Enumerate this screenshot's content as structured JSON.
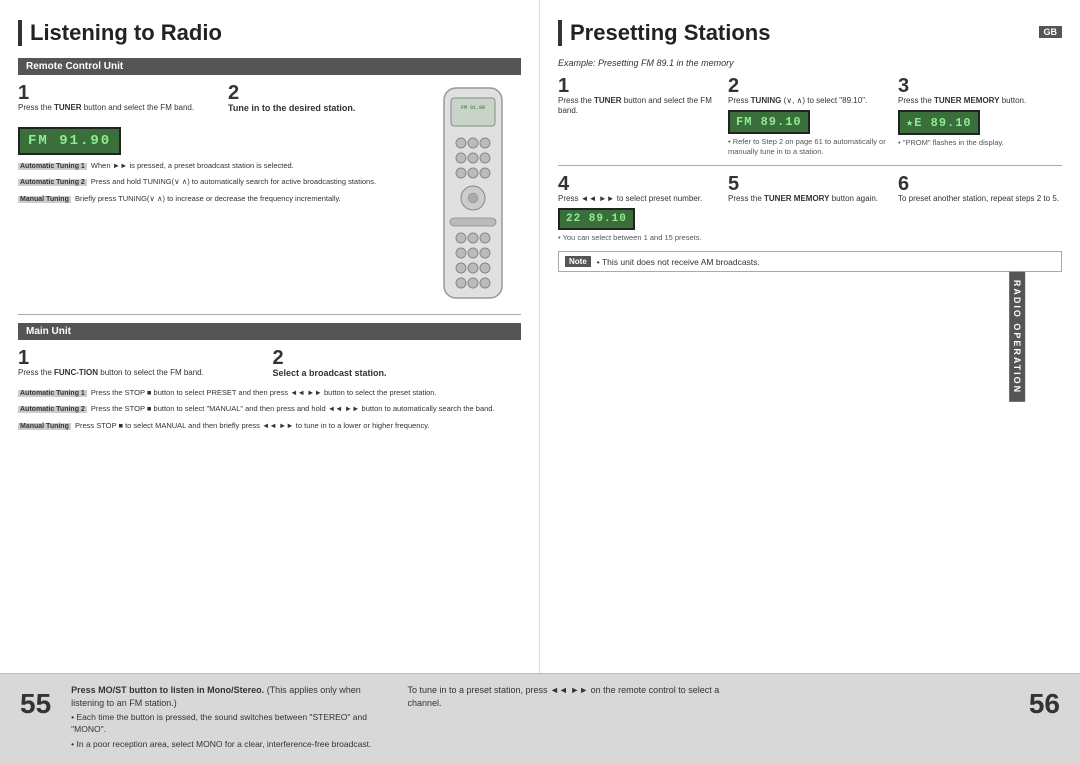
{
  "leftPage": {
    "title": "Listening to Radio",
    "sections": {
      "remoteControl": {
        "header": "Remote Control Unit",
        "step1": {
          "number": "1",
          "text": "Press the ",
          "bold": "TUNER",
          "text2": " button and select the FM band."
        },
        "step2": {
          "number": "2",
          "title": "Tune in to the desired station."
        },
        "tuningNotes": [
          {
            "label": "Automatic Tuning 1",
            "text": "When ►► is pressed, a preset broadcast station is selected."
          },
          {
            "label": "Automatic Tuning 2",
            "text": "Press and hold TUNING(∨ ∧) to automatically search for active broadcasting stations."
          },
          {
            "label": "Manual Tuning",
            "text": "Briefly press TUNING(∨ ∧) to increase or decrease the frequency incrementally."
          }
        ]
      },
      "mainUnit": {
        "header": "Main Unit",
        "step1": {
          "number": "1",
          "text": "Press the FUNC-TION button to select the FM band."
        },
        "step2": {
          "number": "2",
          "title": "Select a broadcast station."
        },
        "mainNotes": [
          {
            "label": "Automatic Tuning 1",
            "text": "Press the STOP ■ button to select PRESET and then press ◄◄ ►► button to select the preset station."
          },
          {
            "label": "Automatic Tuning 2",
            "text": "Press the STOP ■ button to select \"MANUAL\" and then press and hold ◄◄ ►► button to automatically search the band."
          },
          {
            "label": "Manual Tuning",
            "text": "Press STOP ■ to select MANUAL and then briefly press ◄◄ ►► to tune in to a lower or higher frequency."
          }
        ]
      }
    }
  },
  "rightPage": {
    "title": "Presetting Stations",
    "gbBadge": "GB",
    "exampleLabel": "Example: Presetting FM 89.1 in the memory",
    "steps": [
      {
        "number": "1",
        "title": "Press the TUNER button and select the FM band.",
        "display": null
      },
      {
        "number": "2",
        "title": "Press TUNING (∨, ∧) to select \"89.10\".",
        "display": "FM 89.10",
        "subNote": "• Refer to Step 2 on page 61 to automatically or manually tune in to a station."
      },
      {
        "number": "3",
        "title": "Press the TUNER MEMORY button.",
        "display": "★E 89.10",
        "subNote": "• \"PROM\" flashes in the display."
      },
      {
        "number": "4",
        "title": "Press ◄◄ ►► to select preset number.",
        "display": "22 89.10",
        "subNote": "• You can select between 1 and 15 presets."
      },
      {
        "number": "5",
        "title": "Press the TUNER MEMORY button again.",
        "display": null
      },
      {
        "number": "6",
        "title": "To preset another station, repeat steps 2 to 5.",
        "display": null
      }
    ],
    "noteText": "• This unit does not receive AM broadcasts.",
    "radioOpLabel": "RADIO OPERATION"
  },
  "footer": {
    "pageLeft": "55",
    "pageRight": "56",
    "noteLeft": {
      "bold": "Press MO/ST button to listen in Mono/Stereo.",
      "sub": "(This applies only when listening to an FM station.)",
      "bullets": [
        "• Each time the button is pressed, the sound switches between \"STEREO\" and \"MONO\".",
        "• In a poor reception area, select MONO for a clear, interference-free broadcast."
      ]
    },
    "noteRight": {
      "text": "To tune in to a preset station, press ◄◄ ►► on the remote control to select a channel."
    }
  },
  "displays": {
    "fm9190": "FM 91.90",
    "fm8910": "FM 89.10",
    "star8910": "★E 89.10",
    "preset8910": "22  89.10"
  }
}
